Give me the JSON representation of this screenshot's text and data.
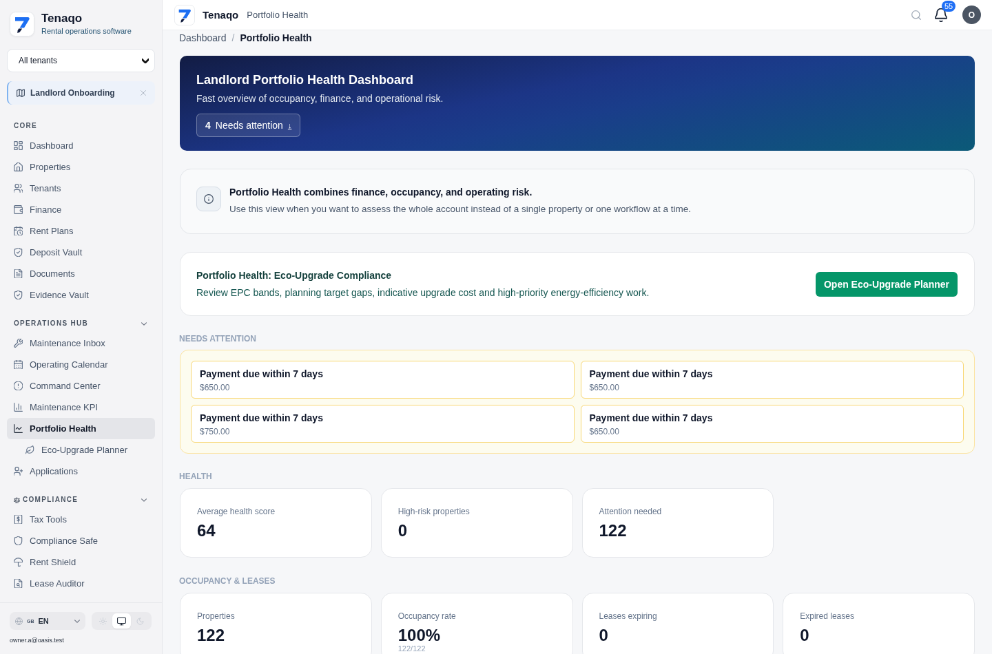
{
  "sidebar": {
    "brand": {
      "name": "Tenaqo",
      "tagline": "Rental operations software"
    },
    "tenant_select": {
      "value": "All tenants"
    },
    "pinned": {
      "label": "Landlord Onboarding"
    },
    "sections": [
      {
        "title": "CORE",
        "collapsible": false,
        "items": [
          {
            "label": "Dashboard",
            "selected": false
          },
          {
            "label": "Properties",
            "selected": false
          },
          {
            "label": "Tenants",
            "selected": false
          },
          {
            "label": "Finance",
            "selected": false
          },
          {
            "label": "Rent Plans",
            "selected": false
          },
          {
            "label": "Deposit Vault",
            "selected": false
          },
          {
            "label": "Documents",
            "selected": false
          },
          {
            "label": "Evidence Vault",
            "selected": false
          }
        ]
      },
      {
        "title": "OPERATIONS HUB",
        "collapsible": true,
        "items": [
          {
            "label": "Maintenance Inbox",
            "selected": false
          },
          {
            "label": "Operating Calendar",
            "selected": false
          },
          {
            "label": "Command Center",
            "selected": false
          },
          {
            "label": "Maintenance KPI",
            "selected": false
          },
          {
            "label": "Portfolio Health",
            "selected": true,
            "children": [
              {
                "label": "Eco-Upgrade Planner",
                "selected": false
              }
            ]
          },
          {
            "label": "Applications",
            "selected": false
          }
        ]
      },
      {
        "title": "COMPLIANCE",
        "collapsible": true,
        "items": [
          {
            "label": "Tax Tools",
            "selected": false
          },
          {
            "label": "Compliance Safe",
            "selected": false
          },
          {
            "label": "Rent Shield",
            "selected": false
          },
          {
            "label": "Lease Auditor",
            "selected": false
          }
        ]
      }
    ],
    "footer": {
      "language": {
        "flag": "GB",
        "code": "EN"
      },
      "themes": [
        {
          "kind": "light",
          "selected": false
        },
        {
          "kind": "system",
          "selected": true
        },
        {
          "kind": "dark",
          "selected": false
        }
      ],
      "email": "owner.a@oasis.test"
    }
  },
  "topbar": {
    "brand": "Tenaqo",
    "page": "Portfolio Health",
    "notifications": "55",
    "avatar": "O"
  },
  "breadcrumb": {
    "separator": "/",
    "items": [
      {
        "label": "Dashboard",
        "current": false
      },
      {
        "label": "Portfolio Health",
        "current": true
      }
    ]
  },
  "hero": {
    "title": "Landlord Portfolio Health Dashboard",
    "subtitle": "Fast overview of occupancy, finance, and operational risk.",
    "button": {
      "count": "4",
      "label": "Needs attention",
      "arrow": "↓"
    }
  },
  "notice": {
    "title": "Portfolio Health combines finance, occupancy, and operating risk.",
    "text": "Use this view when you want to assess the whole account instead of a single property or one workflow at a time."
  },
  "eco_card": {
    "title": "Portfolio Health: Eco-Upgrade Compliance",
    "text": "Review EPC bands, planning target gaps, indicative upgrade cost and high-priority energy-efficiency work.",
    "button": "Open Eco-Upgrade Planner"
  },
  "needs_attention": {
    "title": "NEEDS ATTENTION",
    "items": [
      {
        "title": "Payment due within 7 days",
        "amount": "$650.00"
      },
      {
        "title": "Payment due within 7 days",
        "amount": "$650.00"
      },
      {
        "title": "Payment due within 7 days",
        "amount": "$750.00"
      },
      {
        "title": "Payment due within 7 days",
        "amount": "$650.00"
      }
    ]
  },
  "health": {
    "title": "HEALTH",
    "cards": [
      {
        "label": "Average health score",
        "value": "64"
      },
      {
        "label": "High-risk properties",
        "value": "0"
      },
      {
        "label": "Attention needed",
        "value": "122"
      }
    ]
  },
  "occupancy": {
    "title": "OCCUPANCY & LEASES",
    "cards": [
      {
        "label": "Properties",
        "value": "122"
      },
      {
        "label": "Occupancy rate",
        "value": "100%",
        "detail": "122/122"
      },
      {
        "label": "Leases expiring",
        "value": "0"
      },
      {
        "label": "Expired leases",
        "value": "0"
      }
    ]
  }
}
